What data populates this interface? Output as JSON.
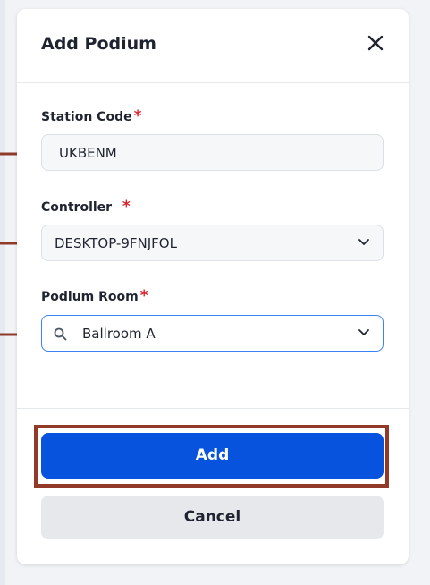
{
  "dialog": {
    "title": "Add Podium",
    "close_icon": "close-icon"
  },
  "fields": {
    "station_code": {
      "label": "Station Code",
      "required": "*",
      "value": "UKBENM"
    },
    "controller": {
      "label": "Controller",
      "required": "*",
      "value": "DESKTOP-9FNJFOL",
      "icon": "chevron-down-icon"
    },
    "podium_room": {
      "label": "Podium Room",
      "required": "*",
      "value": "Ballroom A",
      "icon": "search-icon"
    }
  },
  "buttons": {
    "add": "Add",
    "cancel": "Cancel"
  },
  "colors": {
    "primary": "#0753de",
    "required": "#d8222b",
    "annotation": "#923a2a"
  }
}
